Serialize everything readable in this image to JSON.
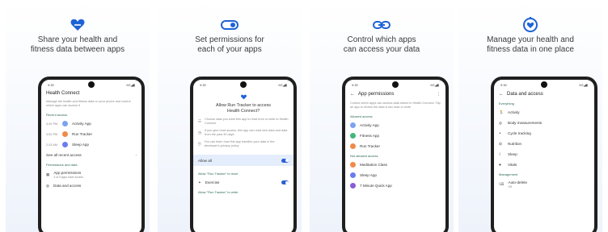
{
  "panels": [
    {
      "icon": "heart-link-icon",
      "headline_1": "Share your health and",
      "headline_2": "fitness data between apps",
      "status_time": "9:30",
      "status_signal": "5G◢▮",
      "screen_title": "Health Connect",
      "intro_text": "Manage the health and fitness data on your phone and control which apps can access it",
      "section_1": "Recent access",
      "recent": [
        {
          "time": "4:40 PM",
          "app": "Activity App",
          "color": "#7ba3f0"
        },
        {
          "time": "3:52 PM",
          "app": "Run Tracker",
          "color": "#f08a4b"
        },
        {
          "time": "2:33 AM",
          "app": "Sleep App",
          "color": "#6b7cf0"
        }
      ],
      "see_all": "See all recent access",
      "section_2": "Permissions and data",
      "perm_item": "App permissions",
      "perm_sub": "4 of 5 apps have access",
      "data_item": "Data and access"
    },
    {
      "icon": "toggle-icon",
      "headline_1": "Set permissions for",
      "headline_2": "each of your apps",
      "status_time": "9:30",
      "status_signal": "5G◢▮",
      "dialog_title_1": "Allow Run Tracker to access",
      "dialog_title_2": "Health Connect?",
      "info_1": "Choose data you want this app to read from or write to Health Connect",
      "info_2": "If you give read access, this app can read new data and data from the past 30 days",
      "info_3": "You can learn how this app handles your data in the developer's privacy policy",
      "allow_all": "Allow all",
      "section_read": "Allow \"Run Tracker\" to read",
      "read_item": "Exercise",
      "section_write": "Allow \"Run Tracker\" to write"
    },
    {
      "icon": "link-icon",
      "headline_1": "Control which apps",
      "headline_2": "can access your data",
      "status_time": "9:30",
      "status_signal": "5G◢▮",
      "screen_title": "App permissions",
      "intro_text": "Control which apps can access data stored in Health Connect. Tap an app to review the data it can read or write",
      "section_allowed": "Allowed access",
      "allowed": [
        {
          "app": "Activity App",
          "color": "#7ba3f0"
        },
        {
          "app": "Fitness App",
          "color": "#43b77a"
        },
        {
          "app": "Run Tracker",
          "color": "#f08a4b"
        }
      ],
      "section_not_allowed": "Not allowed access",
      "not_allowed": [
        {
          "app": "Meditation Class",
          "color": "#f08a4b"
        },
        {
          "app": "Sleep App",
          "color": "#6b7cf0"
        },
        {
          "app": "7 Minute Quick App",
          "color": "#8a5cd6"
        }
      ]
    },
    {
      "icon": "heart-badge-icon",
      "headline_1": "Manage your health and",
      "headline_2": "fitness data in one place",
      "status_time": "9:30",
      "status_signal": "5G◢▮",
      "screen_title": "Data and access",
      "section_1": "Everything",
      "items": [
        {
          "label": "Activity",
          "glyph": "🏃"
        },
        {
          "label": "Body measurements",
          "glyph": "◎"
        },
        {
          "label": "Cycle tracking",
          "glyph": "◓"
        },
        {
          "label": "Nutrition",
          "glyph": "⏣"
        },
        {
          "label": "Sleep",
          "glyph": "☾"
        },
        {
          "label": "Vitals",
          "glyph": "♥"
        }
      ],
      "section_2": "Management",
      "mgmt_item": "Auto-delete",
      "mgmt_sub": "Off"
    }
  ],
  "colors": {
    "accent": "#2c5fd6",
    "heart": "#1e63d6"
  }
}
